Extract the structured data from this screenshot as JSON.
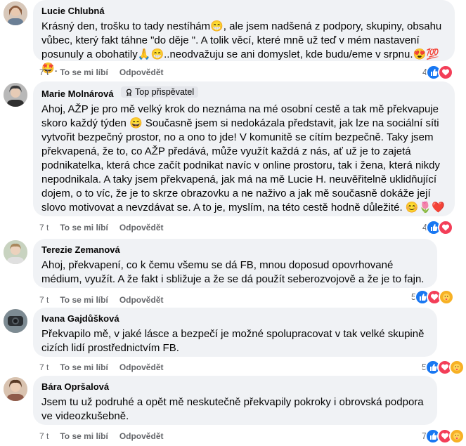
{
  "actions": {
    "like": "To se mi líbí",
    "reply": "Odpovědět"
  },
  "comments": [
    {
      "author": "Lucie Chlubná",
      "badge": "",
      "text": "Krásný den, trošku to tady nestíhám😁, ale jsem nadšená z podpory, skupiny, obsahu vůbec, který fakt táhne \"do děje \". A tolik věcí, které mně už teď v mém nastavení posunuly a obohatily🙏😁..neodvažuju se ani domyslet, kde budu/eme v srpnu.😍💯🤩.",
      "time": "7 t",
      "reaction_count": "4",
      "reactions": [
        "like-icon",
        "love-icon"
      ]
    },
    {
      "author": "Marie Molnárová",
      "badge": "Top přispěvatel",
      "text": "Ahoj, AŽP je pro mě velký krok do neznáma na mé osobní cestě a tak mě překvapuje skoro každý týden 😄 Současně jsem si nedokázala představit, jak lze na sociální síti vytvořit bezpečný prostor, no a ono to jde! V komunitě se cítím bezpečně. Taky jsem překvapená, že to, co AŽP předává, může využít každá z nás, ať už je to zajetá podnikatelka, která chce začít podnikat navíc v online prostoru, tak i žena, která nikdy nepodnikala. A taky jsem překvapená, jak má na mě Lucie H. neuvěřitelně uklidňující dojem, o to víc, že je to skrze obrazovku a ne naživo a jak mě současně dokáže její slovo motivovat a nevzdávat se. A to je, myslím, na této cestě hodně důležité. 😊🌷❤️",
      "time": "7 t",
      "reaction_count": "4",
      "reactions": [
        "like-icon",
        "love-icon"
      ]
    },
    {
      "author": "Terezie Zemanová",
      "badge": "",
      "text": "Ahoj, překvapení, co k čemu všemu se dá FB, mnou doposud opovrhované médium, využít. A že fakt i sbližuje a že se dá použít seberozvojově a že je to fajn.",
      "time": "7 t",
      "reaction_count": "5",
      "reactions": [
        "like-icon",
        "love-icon",
        "care-icon"
      ]
    },
    {
      "author": "Ivana Gajdůšková",
      "badge": "",
      "text": "Překvapilo mě, v jaké lásce a bezpečí je možné spolupracovat v tak velké skupině cizích lidí prostřednictvím FB.",
      "time": "7 t",
      "reaction_count": "5",
      "reactions": [
        "like-icon",
        "love-icon",
        "care-icon"
      ]
    },
    {
      "author": "Bára Opršalová",
      "badge": "",
      "text": "Jsem tu už podruhé a opět mě neskutečně překvapily pokroky i obrovská podpora ve videozkušebně.",
      "time": "7 t",
      "reaction_count": "7",
      "reactions": [
        "like-icon",
        "love-icon",
        "care-icon"
      ]
    }
  ]
}
